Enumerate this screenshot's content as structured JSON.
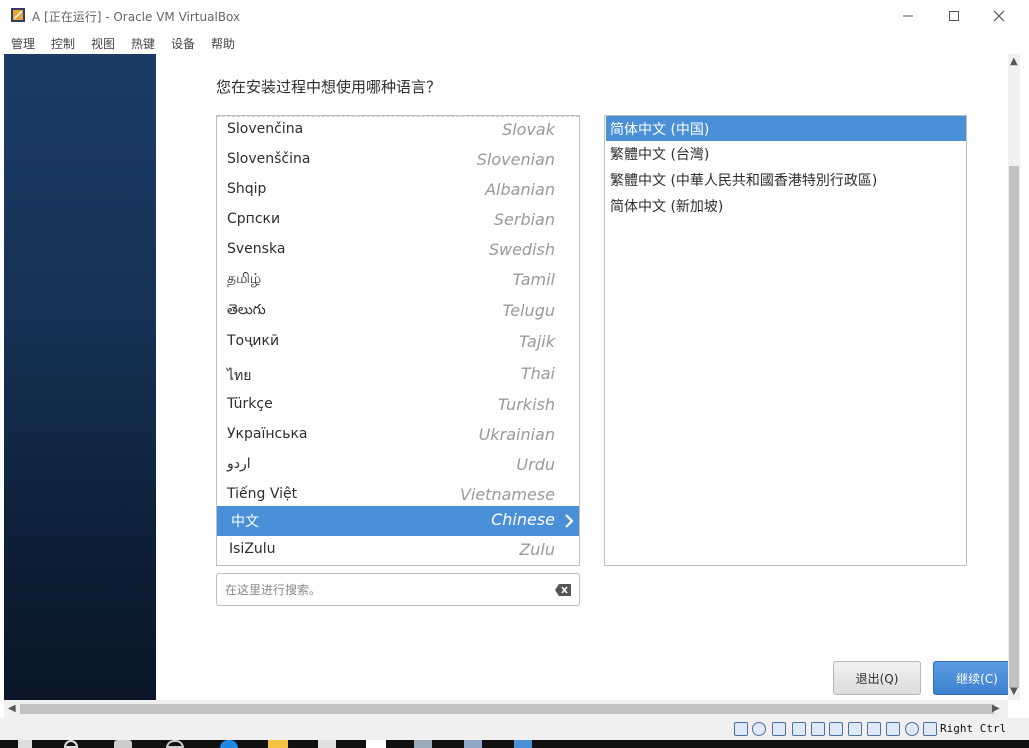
{
  "window": {
    "title": "A [正在运行] - Oracle VM VirtualBox"
  },
  "menubar": {
    "items": [
      "管理",
      "控制",
      "视图",
      "热键",
      "设备",
      "帮助"
    ]
  },
  "installer": {
    "question": "您在安装过程中想使用哪种语言？",
    "languages": [
      {
        "native": "Slovenčina",
        "english": "Slovak"
      },
      {
        "native": "Slovenščina",
        "english": "Slovenian"
      },
      {
        "native": "Shqip",
        "english": "Albanian"
      },
      {
        "native": "Српски",
        "english": "Serbian"
      },
      {
        "native": "Svenska",
        "english": "Swedish"
      },
      {
        "native": "தமிழ்",
        "english": "Tamil"
      },
      {
        "native": "తెలుగు",
        "english": "Telugu"
      },
      {
        "native": "Тоҷикӣ",
        "english": "Tajik"
      },
      {
        "native": "ไทย",
        "english": "Thai"
      },
      {
        "native": "Türkçe",
        "english": "Turkish"
      },
      {
        "native": "Українська",
        "english": "Ukrainian"
      },
      {
        "native": "اردو",
        "english": "Urdu"
      },
      {
        "native": "Tiếng Việt",
        "english": "Vietnamese"
      },
      {
        "native": "中文",
        "english": "Chinese"
      },
      {
        "native": "IsiZulu",
        "english": "Zulu"
      }
    ],
    "selected_language": "Chinese",
    "locales": [
      "简体中文 (中国)",
      "繁體中文 (台灣)",
      "繁體中文 (中華人民共和國香港特別行政區)",
      "简体中文 (新加坡)"
    ],
    "selected_locale": "简体中文 (中国)",
    "search": {
      "placeholder": "在这里进行搜索。",
      "value": ""
    },
    "buttons": {
      "quit": "退出(Q)",
      "continue": "继续(C)"
    }
  },
  "statusbar": {
    "host_key": "Right Ctrl"
  },
  "colors": {
    "selection": "#4a90d9",
    "sidebar": "#163256"
  }
}
